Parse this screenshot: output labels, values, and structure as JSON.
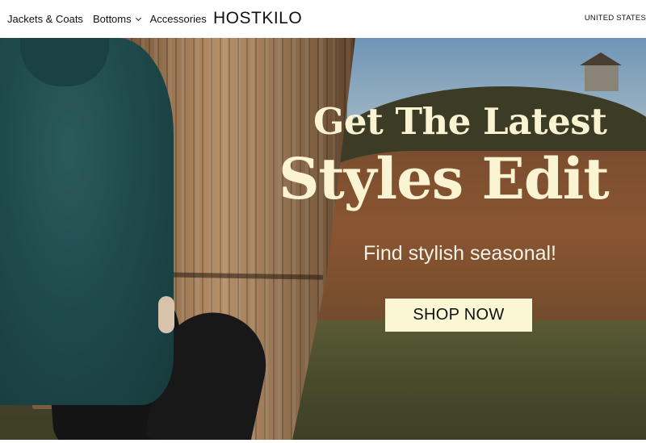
{
  "nav": {
    "items": [
      {
        "label": "Jackets & Coats",
        "has_dropdown": false
      },
      {
        "label": "Bottoms",
        "has_dropdown": true
      },
      {
        "label": "Accessories",
        "has_dropdown": false
      }
    ]
  },
  "brand": {
    "name": "HOSTKILO"
  },
  "region": {
    "label": "UNITED STATES"
  },
  "hero": {
    "headline_line1": "Get The Latest",
    "headline_line2": "Styles Edit",
    "subheadline": "Find stylish seasonal!",
    "cta_label": "SHOP NOW",
    "colors": {
      "headline": "#fbf4d3",
      "cta_background": "#fbf6d3"
    }
  }
}
